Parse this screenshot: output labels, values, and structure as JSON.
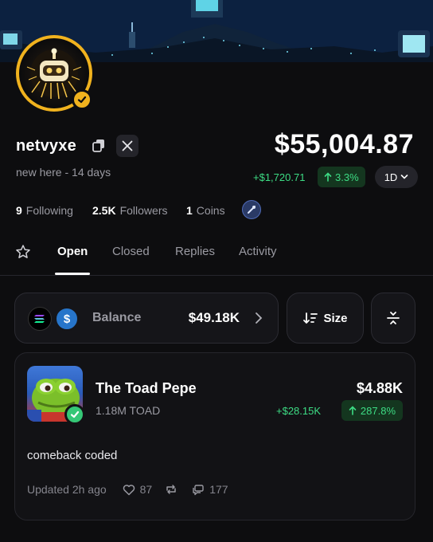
{
  "profile": {
    "username": "netvyxe",
    "bio": "new here - 14 days",
    "net_worth": "$55,004.87",
    "pnl_abs": "+$1,720.71",
    "pnl_pct": "3.3%",
    "range": "1D",
    "following_count": "9",
    "following_label": "Following",
    "followers_count": "2.5K",
    "followers_label": "Followers",
    "coins_count": "1",
    "coins_label": "Coins"
  },
  "tabs": [
    {
      "label": "Open",
      "active": true
    },
    {
      "label": "Closed",
      "active": false
    },
    {
      "label": "Replies",
      "active": false
    },
    {
      "label": "Activity",
      "active": false
    }
  ],
  "balance": {
    "label": "Balance",
    "value": "$49.18K",
    "coin2_symbol": "$"
  },
  "sort": {
    "label": "Size"
  },
  "position": {
    "name": "The Toad Pepe",
    "amount": "1.18M TOAD",
    "value": "$4.88K",
    "pnl_abs": "+$28.15K",
    "pnl_pct": "287.8%",
    "comment": "comeback coded",
    "updated": "Updated 2h ago",
    "likes": "87",
    "replies": "177"
  },
  "colors": {
    "accent_gold": "#f0b21e",
    "positive_green": "#3ddc84",
    "background": "#0d0d0f",
    "card": "#121215"
  },
  "icons": [
    "copy-icon",
    "x-logo-icon",
    "arrow-up-icon",
    "chevron-down-icon",
    "star-icon",
    "chevron-right-icon",
    "sort-icon",
    "filter-icon",
    "heart-icon",
    "repost-icon",
    "reply-icon",
    "check-icon"
  ]
}
